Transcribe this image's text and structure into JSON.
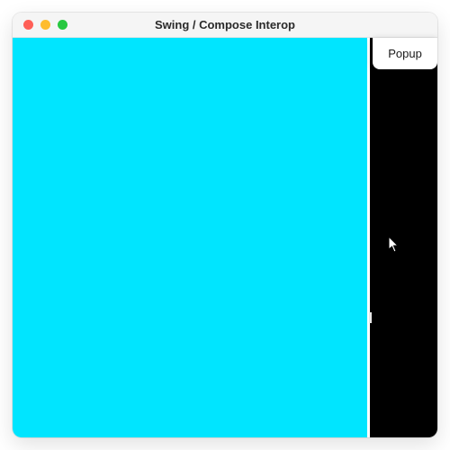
{
  "window": {
    "title": "Swing / Compose Interop"
  },
  "popup": {
    "label": "Popup"
  },
  "colors": {
    "cyan_panel": "#00e5ff",
    "right_panel": "#000000",
    "popup_bg": "#ffffff"
  },
  "icons": {
    "close": "close-icon",
    "minimize": "minimize-icon",
    "maximize": "maximize-icon",
    "cursor": "cursor-icon"
  }
}
